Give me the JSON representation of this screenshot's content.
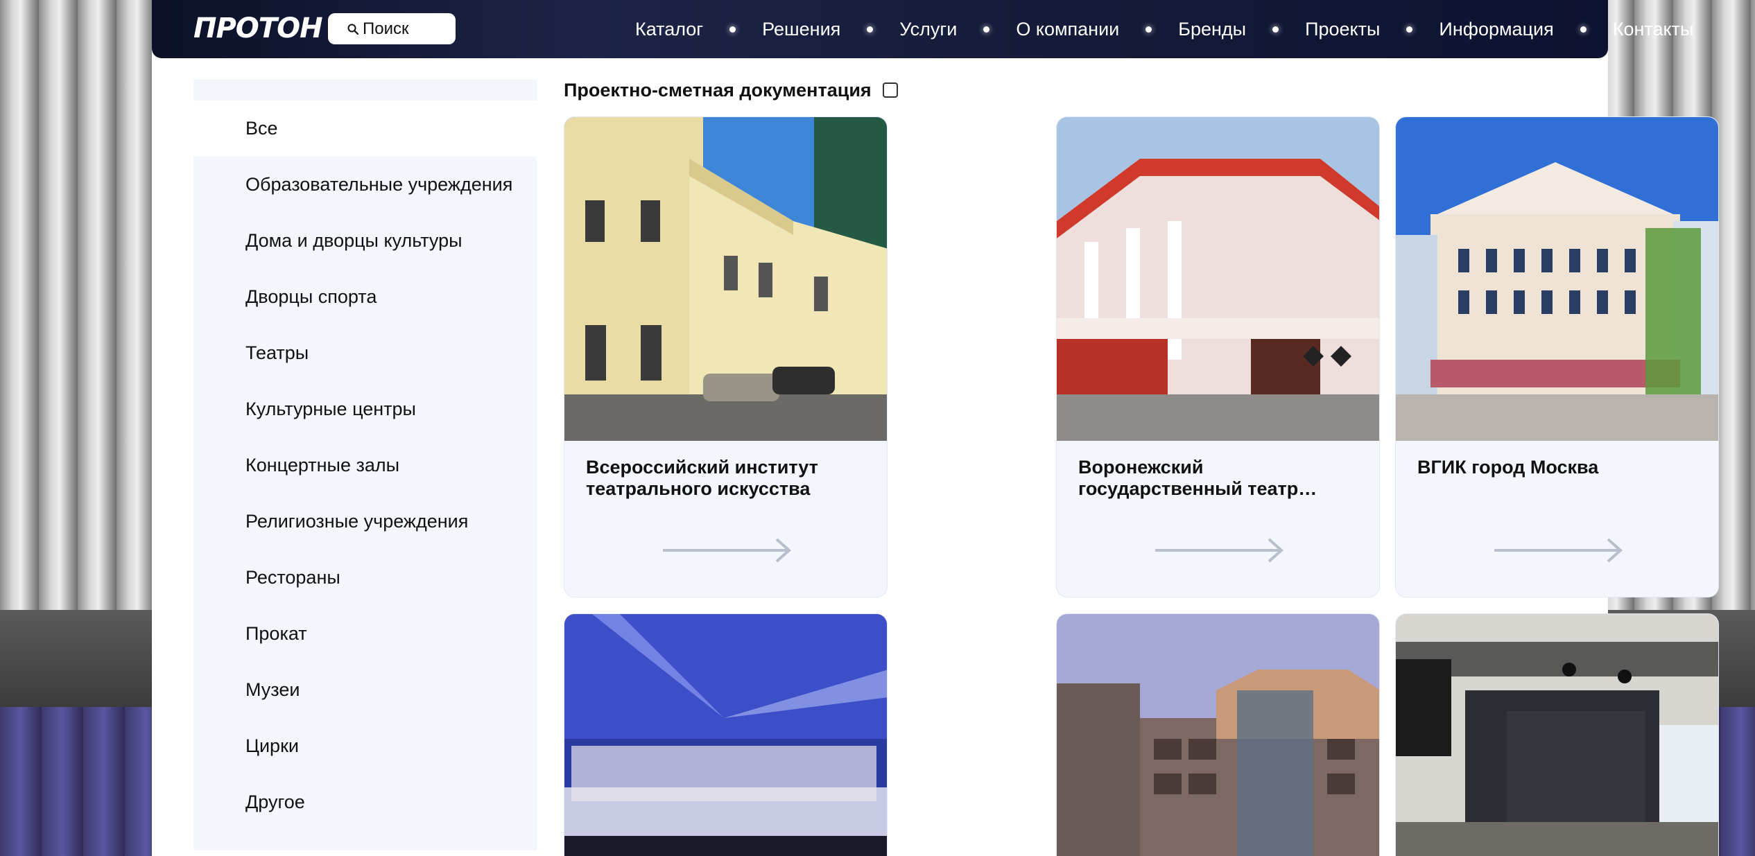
{
  "header": {
    "logo_text": "ПРОТОН",
    "search_label": "Поиск",
    "nav": [
      "Каталог",
      "Решения",
      "Услуги",
      "О компании",
      "Бренды",
      "Проекты",
      "Информация",
      "Контакты"
    ]
  },
  "sidebar": {
    "items": [
      {
        "label": "Все",
        "active": true
      },
      {
        "label": "Образовательные учреждения"
      },
      {
        "label": "Дома и дворцы культуры"
      },
      {
        "label": "Дворцы спорта"
      },
      {
        "label": "Театры"
      },
      {
        "label": "Культурные центры"
      },
      {
        "label": "Концертные залы"
      },
      {
        "label": "Религиозные учреждения"
      },
      {
        "label": "Рестораны"
      },
      {
        "label": "Прокат"
      },
      {
        "label": "Музеи"
      },
      {
        "label": "Цирки"
      },
      {
        "label": "Другое"
      }
    ]
  },
  "filter": {
    "label": "Проектно-сметная документация",
    "checked": false
  },
  "cards": [
    {
      "title": "Всероссийский институт театрального искусства"
    },
    {
      "title": "Воронежский государственный театр юного зрителя"
    },
    {
      "title": "ВГИК город Москва"
    },
    {
      "title": ""
    },
    {
      "title": ""
    },
    {
      "title": ""
    }
  ],
  "colors": {
    "header_bg": "#151b38",
    "sidebar_bg": "#f3f6fd",
    "card_bg": "#f3f6fd",
    "arrow": "#b9bfcc"
  }
}
